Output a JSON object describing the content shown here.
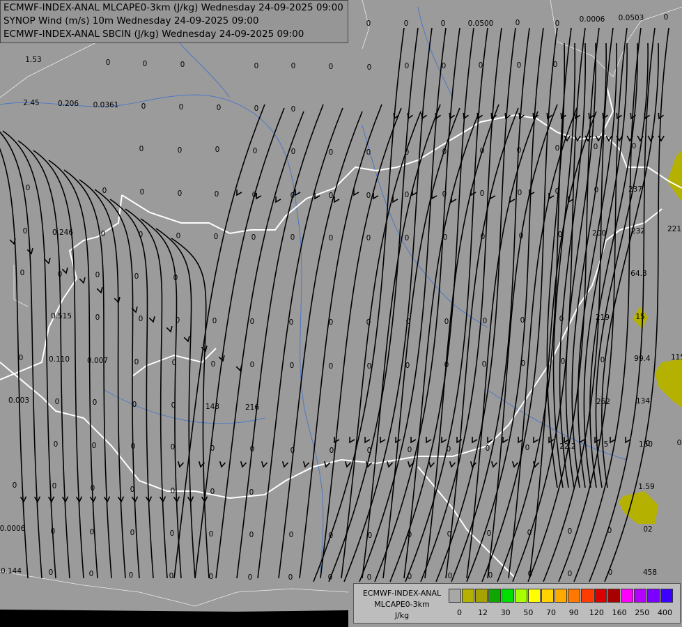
{
  "header": {
    "line1": "ECMWF-INDEX-ANAL MLCAPE0-3km (J/kg) Wednesday 24-09-2025 09:00",
    "line2": "SYNOP Wind (m/s) 10m Wednesday 24-09-2025 09:00",
    "line3": "ECMWF-INDEX-ANAL SBCIN (J/kg) Wednesday 24-09-2025 09:00"
  },
  "legend": {
    "title_line1": "ECMWF-INDEX-ANAL",
    "title_line2": "MLCAPE0-3km",
    "unit": "J/kg",
    "colors": [
      "#a8a8a8",
      "#b5b100",
      "#a6a200",
      "#0fa600",
      "#00e000",
      "#a8ff00",
      "#ffff00",
      "#ffd200",
      "#ffaa00",
      "#ff7800",
      "#ff3c00",
      "#d80000",
      "#a80000",
      "#ff00ff",
      "#b400ff",
      "#7b00ff",
      "#3c00ff",
      "#0028ff",
      "#0080ff",
      "#00c8ff",
      "#00ffff",
      "#ffffff"
    ],
    "ticks": [
      "0",
      "12",
      "30",
      "50",
      "70",
      "90",
      "120",
      "160",
      "250",
      "400"
    ]
  },
  "labels": [
    {
      "t": "1.53"
    },
    {
      "t": "0"
    },
    {
      "t": "0"
    },
    {
      "t": "0"
    },
    {
      "t": "0"
    },
    {
      "t": "0"
    },
    {
      "t": "0"
    },
    {
      "t": "2.45"
    },
    {
      "t": "0.206"
    },
    {
      "t": "0.0361"
    },
    {
      "t": "0"
    },
    {
      "t": "0"
    },
    {
      "t": "0"
    },
    {
      "t": "0"
    },
    {
      "t": "0"
    },
    {
      "t": "0.0500"
    },
    {
      "t": "0.0006"
    },
    {
      "t": "0.0503"
    },
    {
      "t": "0"
    },
    {
      "t": "0"
    },
    {
      "t": "0"
    },
    {
      "t": "0"
    },
    {
      "t": "0"
    },
    {
      "t": "0"
    },
    {
      "t": "0"
    },
    {
      "t": "0"
    },
    {
      "t": "0"
    },
    {
      "t": "0"
    },
    {
      "t": "0"
    },
    {
      "t": "0"
    },
    {
      "t": "0.246"
    },
    {
      "t": "0"
    },
    {
      "t": "0"
    },
    {
      "t": "0"
    },
    {
      "t": "0"
    },
    {
      "t": "0"
    },
    {
      "t": "0.515"
    },
    {
      "t": "0"
    },
    {
      "t": "0.110"
    },
    {
      "t": "0.007"
    },
    {
      "t": "0"
    },
    {
      "t": "0.003"
    },
    {
      "t": "0"
    },
    {
      "t": "0"
    },
    {
      "t": "0.0006"
    },
    {
      "t": "0.144"
    },
    {
      "t": "0"
    },
    {
      "t": "0"
    },
    {
      "t": "0"
    },
    {
      "t": "0"
    },
    {
      "t": "0"
    },
    {
      "t": "0"
    },
    {
      "t": "0"
    },
    {
      "t": "0"
    },
    {
      "t": "0"
    },
    {
      "t": "0"
    },
    {
      "t": "0"
    },
    {
      "t": "0"
    },
    {
      "t": "0"
    },
    {
      "t": "0"
    },
    {
      "t": "0"
    },
    {
      "t": "0"
    },
    {
      "t": "0"
    },
    {
      "t": "0"
    },
    {
      "t": "0"
    },
    {
      "t": "0"
    },
    {
      "t": "0"
    },
    {
      "t": "0"
    },
    {
      "t": "0"
    },
    {
      "t": "0"
    },
    {
      "t": "0"
    },
    {
      "t": "0"
    },
    {
      "t": "0"
    },
    {
      "t": "0"
    },
    {
      "t": "0"
    },
    {
      "t": "0"
    },
    {
      "t": "0"
    },
    {
      "t": "0"
    },
    {
      "t": "0"
    },
    {
      "t": "0"
    },
    {
      "t": "0"
    },
    {
      "t": "0"
    },
    {
      "t": "0"
    },
    {
      "t": "0"
    },
    {
      "t": "0"
    },
    {
      "t": "0"
    },
    {
      "t": "0"
    },
    {
      "t": "0"
    },
    {
      "t": "0"
    },
    {
      "t": "0"
    },
    {
      "t": "0"
    },
    {
      "t": "0"
    },
    {
      "t": "0"
    },
    {
      "t": "0"
    },
    {
      "t": "0"
    },
    {
      "t": "0"
    },
    {
      "t": "0"
    },
    {
      "t": "0"
    },
    {
      "t": "0"
    },
    {
      "t": "0"
    },
    {
      "t": "0"
    },
    {
      "t": "0"
    },
    {
      "t": "0"
    },
    {
      "t": "0"
    },
    {
      "t": "0"
    },
    {
      "t": "0"
    },
    {
      "t": "0"
    },
    {
      "t": "0"
    },
    {
      "t": "0"
    },
    {
      "t": "0"
    },
    {
      "t": "0"
    },
    {
      "t": "0"
    },
    {
      "t": "0"
    },
    {
      "t": "0"
    },
    {
      "t": "0"
    },
    {
      "t": "0"
    },
    {
      "t": "0"
    },
    {
      "t": "0"
    },
    {
      "t": "0"
    },
    {
      "t": "0"
    },
    {
      "t": "0"
    },
    {
      "t": "0"
    },
    {
      "t": "0"
    },
    {
      "t": "0"
    },
    {
      "t": "0"
    },
    {
      "t": "0"
    },
    {
      "t": "0"
    },
    {
      "t": "0"
    },
    {
      "t": "0"
    },
    {
      "t": "0"
    },
    {
      "t": "0"
    },
    {
      "t": "0"
    },
    {
      "t": "0"
    },
    {
      "t": "0"
    },
    {
      "t": "0"
    },
    {
      "t": "0"
    },
    {
      "t": "0"
    },
    {
      "t": "0"
    },
    {
      "t": "0"
    },
    {
      "t": "0"
    },
    {
      "t": "0"
    },
    {
      "t": "0"
    },
    {
      "t": "0"
    },
    {
      "t": "0"
    },
    {
      "t": "0"
    },
    {
      "t": "0"
    },
    {
      "t": "0"
    },
    {
      "t": "0"
    },
    {
      "t": "0"
    },
    {
      "t": "0"
    },
    {
      "t": "0"
    },
    {
      "t": "0"
    },
    {
      "t": "0"
    },
    {
      "t": "0"
    },
    {
      "t": "0"
    },
    {
      "t": "0"
    },
    {
      "t": "0"
    },
    {
      "t": "0"
    },
    {
      "t": "0"
    },
    {
      "t": "0"
    },
    {
      "t": "0"
    },
    {
      "t": "0"
    },
    {
      "t": "0"
    },
    {
      "t": "0"
    },
    {
      "t": "0"
    },
    {
      "t": "0"
    },
    {
      "t": "0"
    },
    {
      "t": "143"
    },
    {
      "t": "216"
    },
    {
      "t": "237"
    },
    {
      "t": "232"
    },
    {
      "t": "221"
    },
    {
      "t": "200"
    },
    {
      "t": "64.3"
    },
    {
      "t": "219"
    },
    {
      "t": "15"
    },
    {
      "t": "99.4"
    },
    {
      "t": "115"
    },
    {
      "t": "262"
    },
    {
      "t": "134"
    },
    {
      "t": "5"
    },
    {
      "t": "150"
    },
    {
      "t": "0"
    },
    {
      "t": "22.2"
    },
    {
      "t": "1.59"
    },
    {
      "t": "02"
    },
    {
      "t": "458"
    }
  ]
}
